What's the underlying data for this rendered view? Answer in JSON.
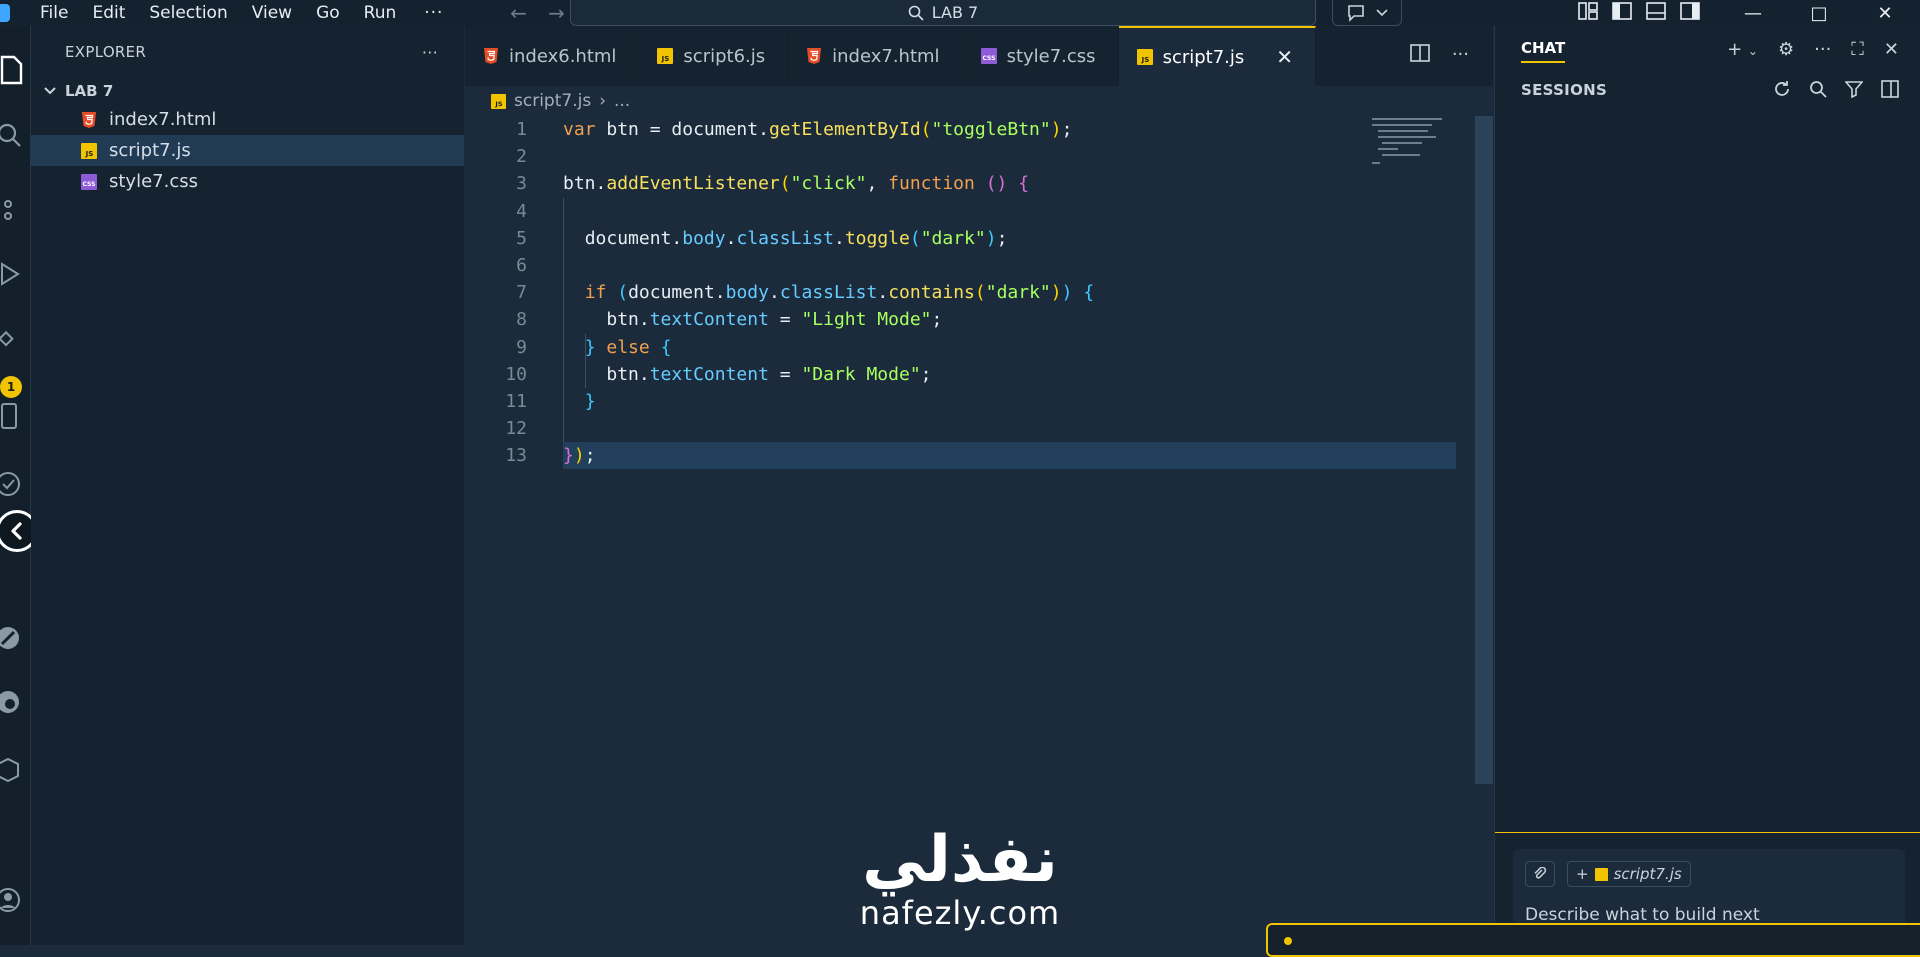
{
  "menu": [
    "File",
    "Edit",
    "Selection",
    "View",
    "Go",
    "Run"
  ],
  "menu_more": "···",
  "search_title": "LAB 7",
  "explorer": {
    "title": "EXPLORER",
    "more": "···",
    "folder": "LAB 7",
    "files": [
      {
        "name": "index7.html",
        "type": "html"
      },
      {
        "name": "script7.js",
        "type": "js",
        "selected": true
      },
      {
        "name": "style7.css",
        "type": "css"
      }
    ]
  },
  "activity_badge": "1",
  "tabs": [
    {
      "label": "index6.html",
      "type": "html"
    },
    {
      "label": "script6.js",
      "type": "js"
    },
    {
      "label": "index7.html",
      "type": "html"
    },
    {
      "label": "style7.css",
      "type": "css"
    },
    {
      "label": "script7.js",
      "type": "js",
      "active": true
    }
  ],
  "breadcrumb": {
    "file": "script7.js",
    "rest": "..."
  },
  "code_lines": [
    "var btn = document.getElementById(\"toggleBtn\");",
    "",
    "btn.addEventListener(\"click\", function () {",
    "",
    "  document.body.classList.toggle(\"dark\");",
    "",
    "  if (document.body.classList.contains(\"dark\")) {",
    "    btn.textContent = \"Light Mode\";",
    "  } else {",
    "    btn.textContent = \"Dark Mode\";",
    "  }",
    "",
    "});"
  ],
  "line_numbers": [
    "1",
    "2",
    "3",
    "4",
    "5",
    "6",
    "7",
    "8",
    "9",
    "10",
    "11",
    "12",
    "13"
  ],
  "current_line": 13,
  "chat": {
    "title": "CHAT",
    "sessions": "SESSIONS",
    "context_file": "script7.js",
    "placeholder": "Describe what to build next"
  },
  "watermark": {
    "arabic": "نفذلي",
    "latin": "nafezly.com"
  },
  "colors": {
    "accent": "#f0c400",
    "background": "#1b2b3b",
    "sidebar": "#152330",
    "selection": "#213b55"
  }
}
